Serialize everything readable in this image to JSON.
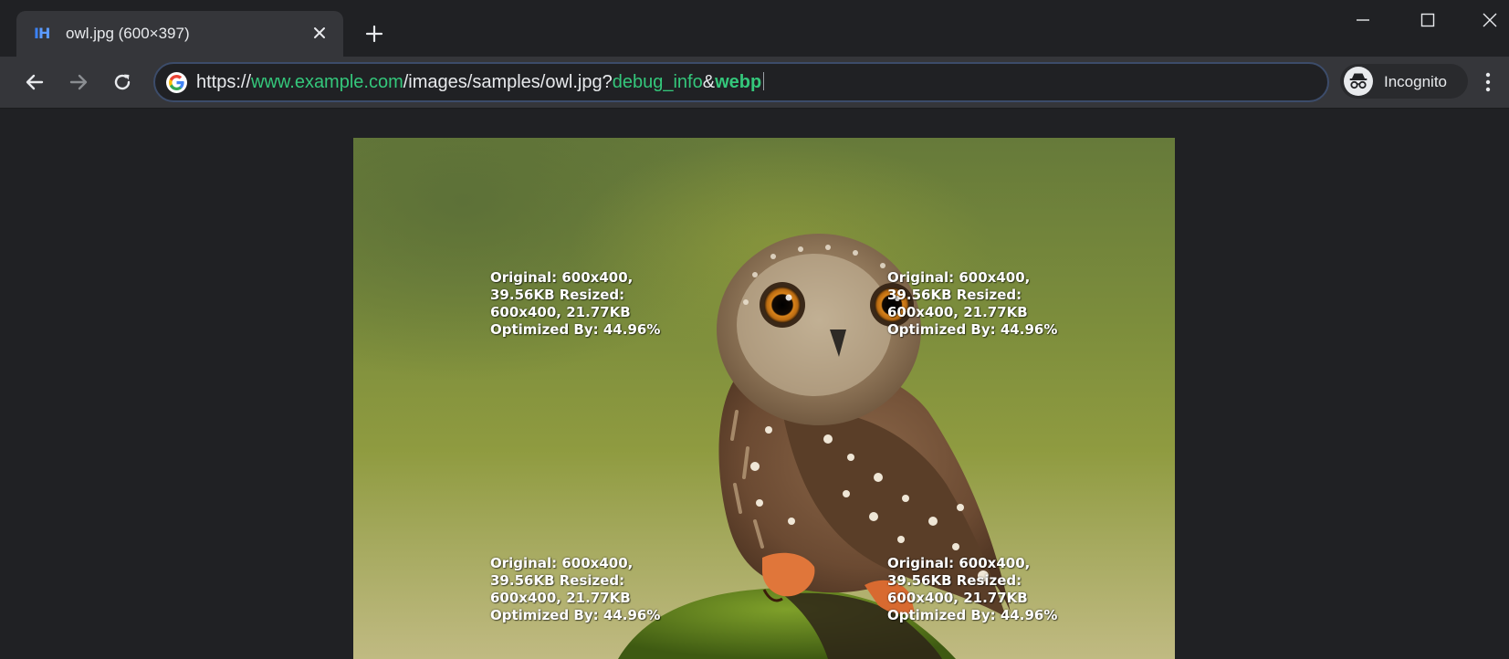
{
  "tab": {
    "title": "owl.jpg (600×397)",
    "favicon_text_1": "I",
    "favicon_text_2": "H"
  },
  "address_bar": {
    "scheme": "https://",
    "host": "www.example.com",
    "path": "/images/samples/owl.jpg?",
    "param_1": "debug_info",
    "separator": "&",
    "param_2": "webp"
  },
  "profile": {
    "label": "Incognito"
  },
  "overlay_text": {
    "top_left": "Original: 600x400, 39.56KB Resized: 600x400, 21.77KB Optimized By: 44.96%",
    "top_right": "Original: 600x400, 39.56KB Resized: 600x400, 21.77KB Optimized By: 44.96%",
    "bottom_left": "Original: 600x400, 39.56KB Resized: 600x400, 21.77KB Optimized By: 44.96%",
    "bottom_right": "Original: 600x400, 39.56KB Resized: 600x400, 21.77KB Optimized By: 44.96%"
  },
  "icons": {
    "tab_close": "close-icon",
    "new_tab": "plus-icon",
    "back": "arrow-left-icon",
    "forward": "arrow-right-icon",
    "reload": "reload-icon",
    "site": "google-g-icon",
    "incognito": "incognito-icon",
    "menu": "kebab-menu-icon"
  },
  "colors": {
    "url_highlight": "#34c77b",
    "browser_dark": "#202124",
    "toolbar": "#35363a"
  }
}
